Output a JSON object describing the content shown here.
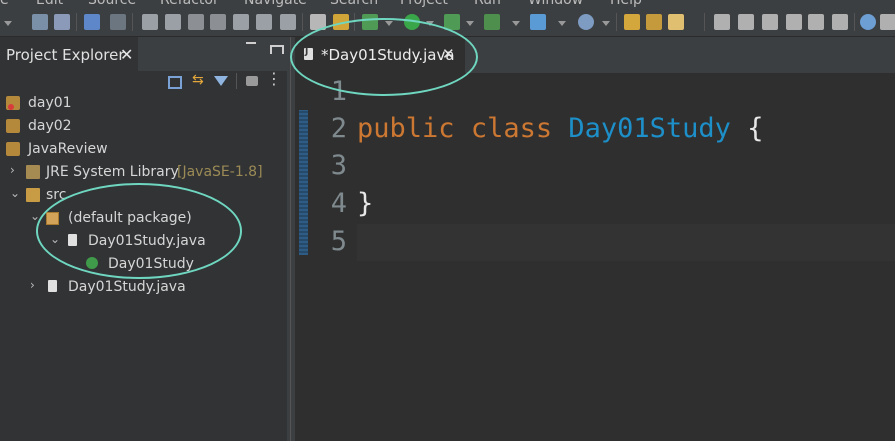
{
  "menu": [
    "e",
    "Edit",
    "Source",
    "Refactor",
    "Navigate",
    "Search",
    "Project",
    "Run",
    "Window",
    "Help"
  ],
  "toolbar_icons": [
    "save-icon",
    "save-all-icon",
    "terminal-icon",
    "debug-skip-icon",
    "resume-icon",
    "suspend-icon",
    "terminate-icon",
    "disconnect-icon",
    "step-into-icon",
    "step-over-icon",
    "step-return-icon",
    "drop-frame-icon",
    "use-step-filters-icon",
    "debug-icon",
    "run-icon",
    "coverage-icon",
    "external-tools-icon",
    "new-java-class-icon",
    "open-type-icon",
    "search-icon",
    "pin-icon",
    "show-whitespace-icon",
    "block-selection-icon",
    "globe-icon"
  ],
  "project_explorer": {
    "tab_label": "Project Explorer",
    "close_glyph": "✕",
    "view_tool_icons": [
      "collapse-all-icon",
      "link-with-editor-icon",
      "filter-icon",
      "view-menu-icon"
    ],
    "tree": [
      {
        "label": "day01",
        "icon": "project-error-icon",
        "twisty": ""
      },
      {
        "label": "day02",
        "icon": "project-icon",
        "twisty": ""
      },
      {
        "label": "JavaReview",
        "icon": "project-icon",
        "twisty": ""
      },
      {
        "label": "JRE System Library",
        "extra": "[JavaSE-1.8]",
        "icon": "library-icon",
        "twisty": "›"
      },
      {
        "label": "src",
        "icon": "source-folder-icon",
        "twisty": "⌄"
      },
      {
        "label": "(default package)",
        "icon": "package-icon",
        "twisty": "⌄"
      },
      {
        "label": "Day01Study.java",
        "icon": "java-file-icon",
        "twisty": "⌄"
      },
      {
        "label": "Day01Study",
        "icon": "class-icon",
        "twisty": ""
      },
      {
        "label": "Day01Study.java",
        "icon": "java-file-icon",
        "twisty": "›"
      }
    ]
  },
  "editor": {
    "tab_label": "*Day01Study.java",
    "close_glyph": "✕",
    "line_numbers": [
      "1",
      "2",
      "3",
      "4",
      "5"
    ],
    "code": {
      "line2_kw1": "public",
      "line2_kw2": "class",
      "line2_name": "Day01Study",
      "line2_brace": "{",
      "line4_brace": "}"
    }
  },
  "colors": {
    "keyword": "#cc7832",
    "class_name": "#1d8fc9",
    "highlight_ring": "#6fd6c0"
  }
}
